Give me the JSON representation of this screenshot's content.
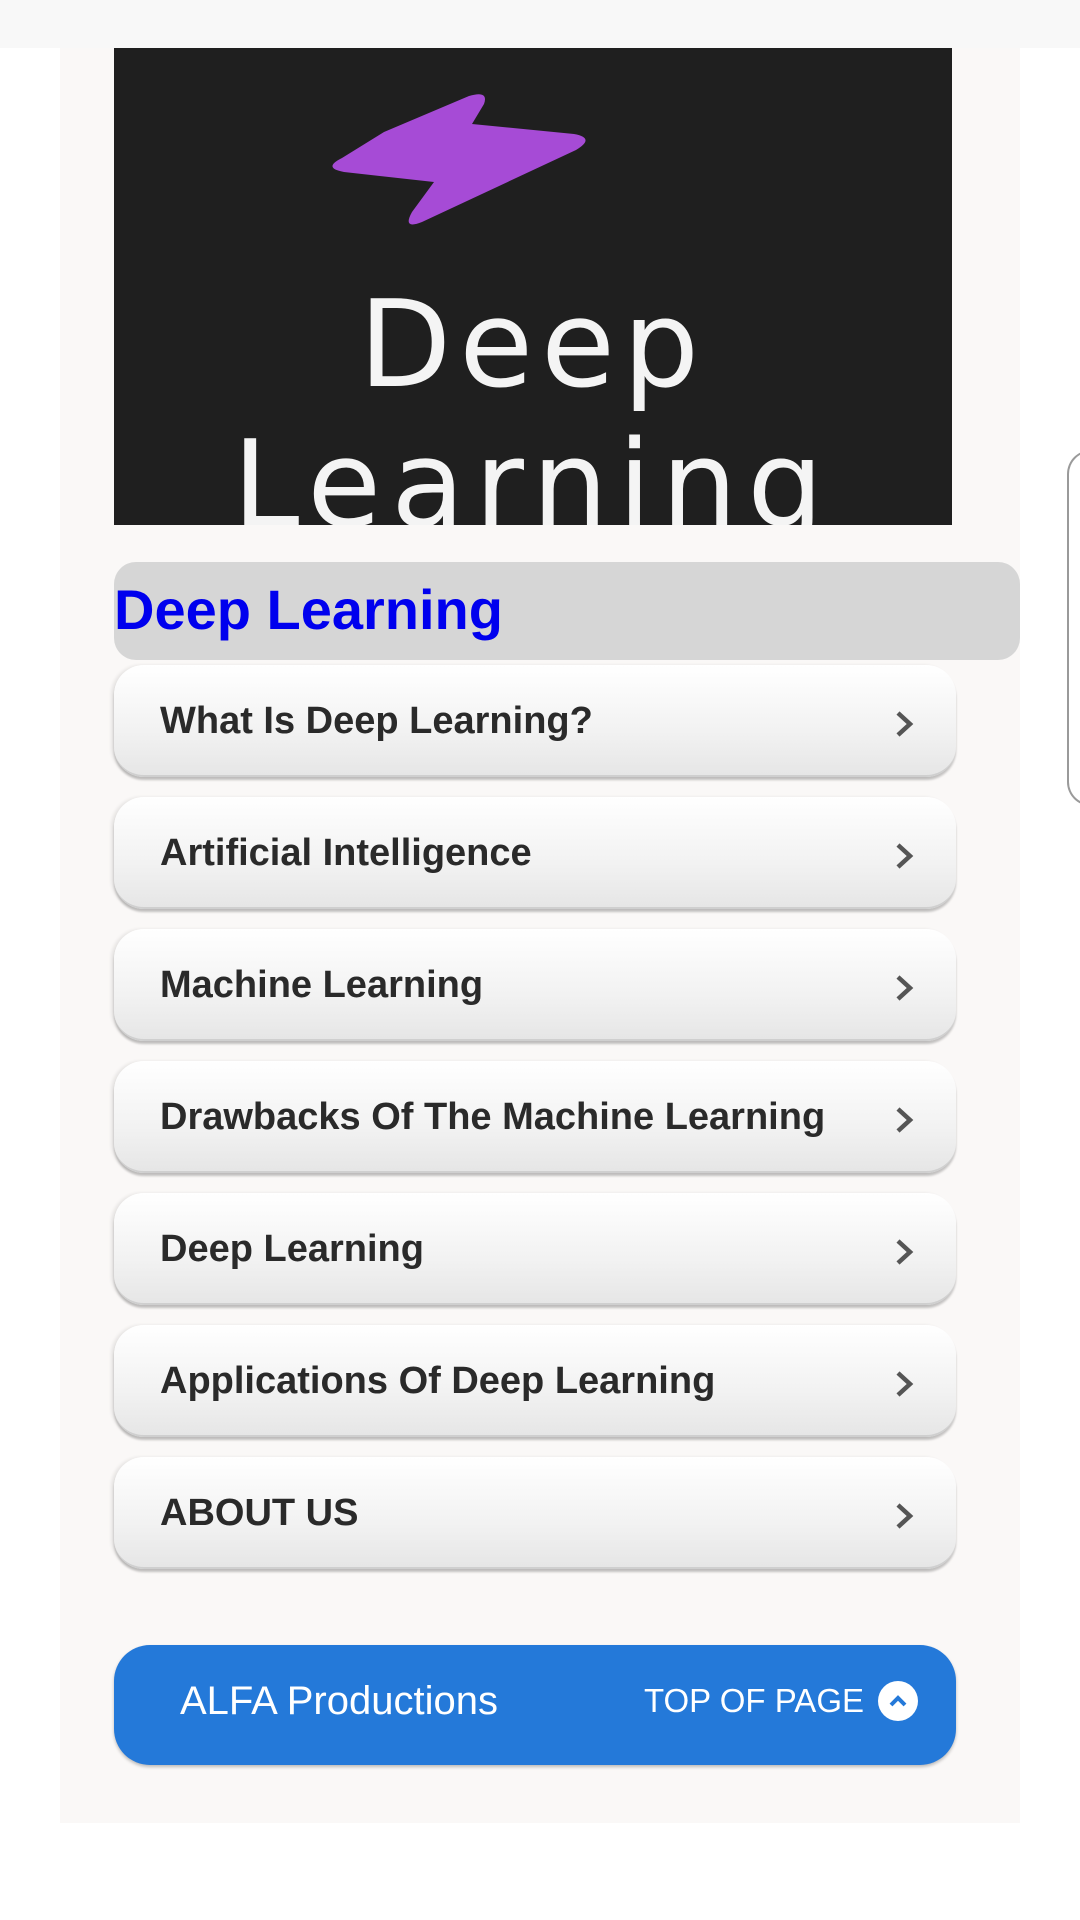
{
  "hero": {
    "line1": "Deep",
    "line2": "Learning",
    "logo_icon": "lightning-bolt-icon",
    "bolt_color": "#a64bd6",
    "background": "#1f1f1f"
  },
  "section": {
    "title": "Deep Learning",
    "title_color": "#0000ee"
  },
  "menu": {
    "items": [
      {
        "label": "What Is Deep Learning?",
        "icon": "chevron-right-icon"
      },
      {
        "label": "Artificial Intelligence",
        "icon": "chevron-right-icon"
      },
      {
        "label": "Machine Learning",
        "icon": "chevron-right-icon"
      },
      {
        "label": "Drawbacks Of The Machine Learning",
        "icon": "chevron-right-icon"
      },
      {
        "label": "Deep Learning",
        "icon": "chevron-right-icon"
      },
      {
        "label": "Applications Of Deep Learning",
        "icon": "chevron-right-icon"
      },
      {
        "label": "ABOUT US",
        "icon": "chevron-right-icon"
      }
    ]
  },
  "footer": {
    "brand": "ALFA Productions",
    "top_link": "TOP OF PAGE",
    "top_icon": "chevron-up-circle-icon",
    "color": "#2479d9"
  }
}
